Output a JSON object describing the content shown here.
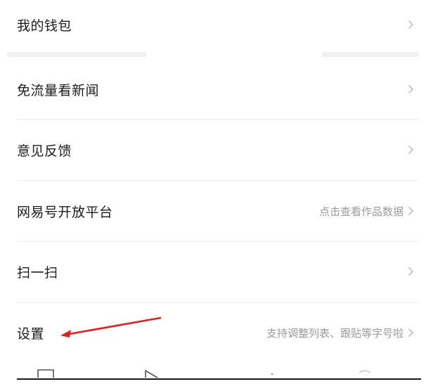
{
  "menu": {
    "items": [
      {
        "label": "我的钱包",
        "hint": ""
      },
      {
        "label": "免流量看新闻",
        "hint": ""
      },
      {
        "label": "意见反馈",
        "hint": ""
      },
      {
        "label": "网易号开放平台",
        "hint": "点击查看作品数据"
      },
      {
        "label": "扫一扫",
        "hint": ""
      },
      {
        "label": "设置",
        "hint": "支持调整列表、跟贴等字号啦"
      }
    ]
  },
  "annotation": {
    "arrow_color": "#e02020"
  },
  "icons": {
    "row_chevron": "chevron-right-icon"
  },
  "colors": {
    "text": "#1c1c1c",
    "hint": "#9a9a9a",
    "divider": "#ededed"
  }
}
